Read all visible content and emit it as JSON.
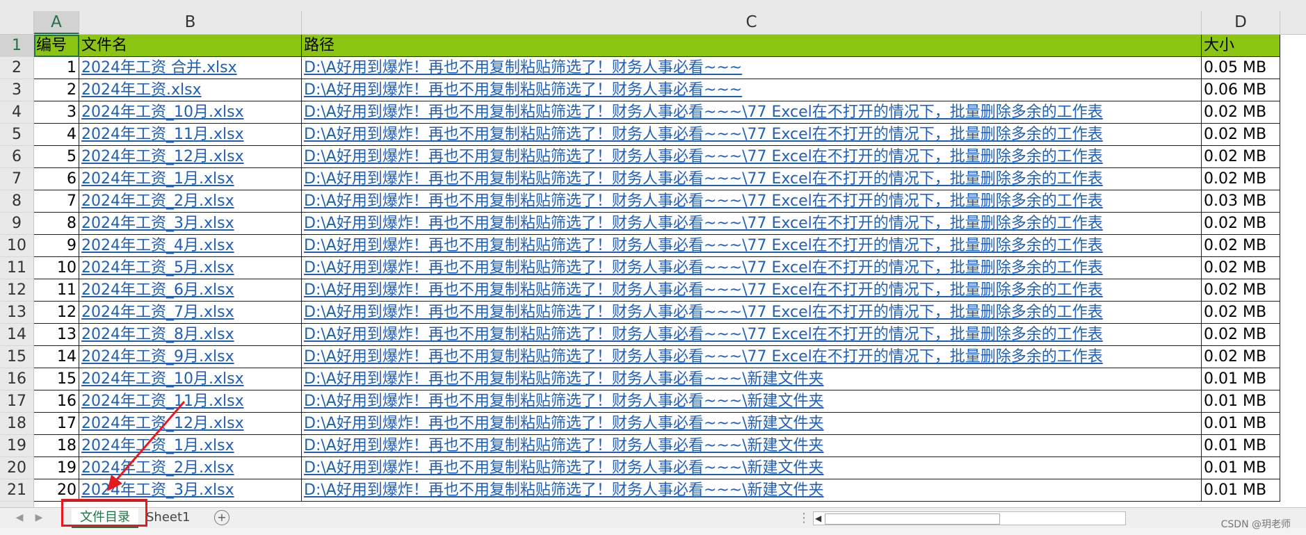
{
  "columns": [
    "A",
    "B",
    "C",
    "D"
  ],
  "header_row": {
    "num": "1",
    "id": "编号",
    "name": "文件名",
    "path": "路径",
    "size": "大小"
  },
  "rows": [
    {
      "num": "2",
      "id": "1",
      "name": "2024年工资 合并.xlsx",
      "path": "D:\\A好用到爆炸！再也不用复制粘贴筛选了！财务人事必看~~~",
      "size": "0.05   MB"
    },
    {
      "num": "3",
      "id": "2",
      "name": "2024年工资.xlsx",
      "path": "D:\\A好用到爆炸！再也不用复制粘贴筛选了！财务人事必看~~~",
      "size": "0.06   MB"
    },
    {
      "num": "4",
      "id": "3",
      "name": "2024年工资_10月.xlsx",
      "path": "D:\\A好用到爆炸！再也不用复制粘贴筛选了！财务人事必看~~~\\77 Excel在不打开的情况下，批量删除多余的工作表",
      "size": "0.02   MB"
    },
    {
      "num": "5",
      "id": "4",
      "name": "2024年工资_11月.xlsx",
      "path": "D:\\A好用到爆炸！再也不用复制粘贴筛选了！财务人事必看~~~\\77 Excel在不打开的情况下，批量删除多余的工作表",
      "size": "0.02   MB"
    },
    {
      "num": "6",
      "id": "5",
      "name": "2024年工资_12月.xlsx",
      "path": "D:\\A好用到爆炸！再也不用复制粘贴筛选了！财务人事必看~~~\\77 Excel在不打开的情况下，批量删除多余的工作表",
      "size": "0.02   MB"
    },
    {
      "num": "7",
      "id": "6",
      "name": "2024年工资_1月.xlsx",
      "path": "D:\\A好用到爆炸！再也不用复制粘贴筛选了！财务人事必看~~~\\77 Excel在不打开的情况下，批量删除多余的工作表",
      "size": "0.02   MB"
    },
    {
      "num": "8",
      "id": "7",
      "name": "2024年工资_2月.xlsx",
      "path": "D:\\A好用到爆炸！再也不用复制粘贴筛选了！财务人事必看~~~\\77 Excel在不打开的情况下，批量删除多余的工作表",
      "size": "0.03   MB"
    },
    {
      "num": "9",
      "id": "8",
      "name": "2024年工资_3月.xlsx",
      "path": "D:\\A好用到爆炸！再也不用复制粘贴筛选了！财务人事必看~~~\\77 Excel在不打开的情况下，批量删除多余的工作表",
      "size": "0.02   MB"
    },
    {
      "num": "10",
      "id": "9",
      "name": "2024年工资_4月.xlsx",
      "path": "D:\\A好用到爆炸！再也不用复制粘贴筛选了！财务人事必看~~~\\77 Excel在不打开的情况下，批量删除多余的工作表",
      "size": "0.02   MB"
    },
    {
      "num": "11",
      "id": "10",
      "name": "2024年工资_5月.xlsx",
      "path": "D:\\A好用到爆炸！再也不用复制粘贴筛选了！财务人事必看~~~\\77 Excel在不打开的情况下，批量删除多余的工作表",
      "size": "0.02   MB"
    },
    {
      "num": "12",
      "id": "11",
      "name": "2024年工资_6月.xlsx",
      "path": "D:\\A好用到爆炸！再也不用复制粘贴筛选了！财务人事必看~~~\\77 Excel在不打开的情况下，批量删除多余的工作表",
      "size": "0.02   MB"
    },
    {
      "num": "13",
      "id": "12",
      "name": "2024年工资_7月.xlsx",
      "path": "D:\\A好用到爆炸！再也不用复制粘贴筛选了！财务人事必看~~~\\77 Excel在不打开的情况下，批量删除多余的工作表",
      "size": "0.02   MB"
    },
    {
      "num": "14",
      "id": "13",
      "name": "2024年工资_8月.xlsx",
      "path": "D:\\A好用到爆炸！再也不用复制粘贴筛选了！财务人事必看~~~\\77 Excel在不打开的情况下，批量删除多余的工作表",
      "size": "0.02   MB"
    },
    {
      "num": "15",
      "id": "14",
      "name": "2024年工资_9月.xlsx",
      "path": "D:\\A好用到爆炸！再也不用复制粘贴筛选了！财务人事必看~~~\\77 Excel在不打开的情况下，批量删除多余的工作表",
      "size": "0.02   MB"
    },
    {
      "num": "16",
      "id": "15",
      "name": "2024年工资_10月.xlsx",
      "path": "D:\\A好用到爆炸！再也不用复制粘贴筛选了！财务人事必看~~~\\新建文件夹",
      "size": "0.01   MB"
    },
    {
      "num": "17",
      "id": "16",
      "name": "2024年工资_11月.xlsx",
      "path": "D:\\A好用到爆炸！再也不用复制粘贴筛选了！财务人事必看~~~\\新建文件夹",
      "size": "0.01   MB"
    },
    {
      "num": "18",
      "id": "17",
      "name": "2024年工资_12月.xlsx",
      "path": "D:\\A好用到爆炸！再也不用复制粘贴筛选了！财务人事必看~~~\\新建文件夹",
      "size": "0.01   MB"
    },
    {
      "num": "19",
      "id": "18",
      "name": "2024年工资_1月.xlsx",
      "path": "D:\\A好用到爆炸！再也不用复制粘贴筛选了！财务人事必看~~~\\新建文件夹",
      "size": "0.01   MB"
    },
    {
      "num": "20",
      "id": "19",
      "name": "2024年工资_2月.xlsx",
      "path": "D:\\A好用到爆炸！再也不用复制粘贴筛选了！财务人事必看~~~\\新建文件夹",
      "size": "0.01   MB"
    },
    {
      "num": "21",
      "id": "20",
      "name": "2024年工资_3月.xlsx",
      "path": "D:\\A好用到爆炸！再也不用复制粘贴筛选了！财务人事必看~~~\\新建文件夹",
      "size": "0.01   MB"
    }
  ],
  "sheet_tabs": {
    "active": "文件目录",
    "other": "Sheet1",
    "add": "+"
  },
  "nav": {
    "prev": "◀",
    "next": "▶",
    "dots": "⋮"
  },
  "watermark": "CSDN @玥老师",
  "colors": {
    "header_fill": "#8cc414",
    "link": "#1f5fb5",
    "accent": "#217346",
    "annotation": "#e8191c"
  }
}
